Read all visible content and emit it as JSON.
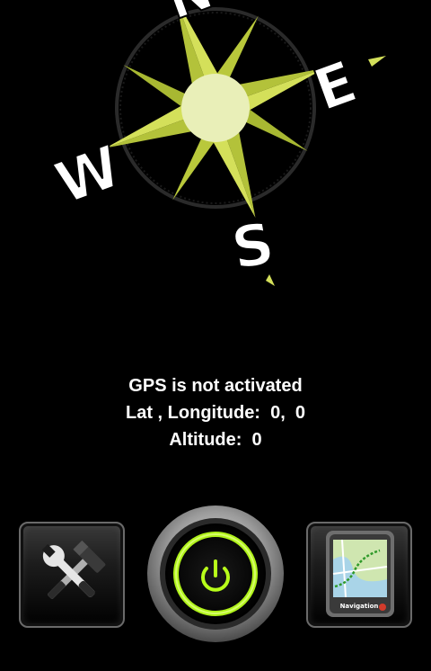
{
  "compass": {
    "north": "N",
    "east": "E",
    "south": "S",
    "west": "W"
  },
  "status": {
    "gps_message": "GPS is not activated",
    "lat_long": "Lat , Longitude:  0,  0",
    "altitude": "Altitude:  0"
  },
  "toolbar": {
    "navigation_label": "Navigation"
  },
  "colors": {
    "background": "#000000",
    "rose_green": "#d4e05a",
    "power_glow": "#b8ff1a"
  },
  "icons": {
    "settings": "hammer-wrench-icon",
    "power": "power-icon",
    "navigation": "map-icon"
  }
}
